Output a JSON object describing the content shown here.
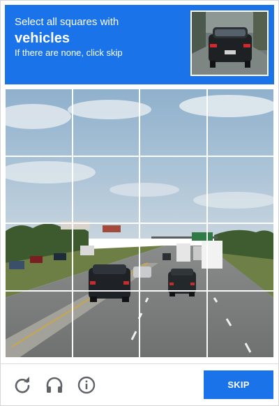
{
  "header": {
    "instruction": "Select all squares with",
    "target": "vehicles",
    "hint": "If there are none, click skip"
  },
  "sample_image": {
    "icon": "car-rear-photo-icon"
  },
  "grid": {
    "rows": 4,
    "cols": 4,
    "tiles": [
      "tile-1-1",
      "tile-1-2",
      "tile-1-3",
      "tile-1-4",
      "tile-2-1",
      "tile-2-2",
      "tile-2-3",
      "tile-2-4",
      "tile-3-1",
      "tile-3-2",
      "tile-3-3",
      "tile-3-4",
      "tile-4-1",
      "tile-4-2",
      "tile-4-3",
      "tile-4-4"
    ]
  },
  "footer": {
    "reload_icon": "reload-icon",
    "audio_icon": "headphones-icon",
    "info_icon": "info-icon",
    "skip_label": "SKIP"
  },
  "colors": {
    "accent": "#1a73e8",
    "icon_gray": "#5f6368"
  }
}
